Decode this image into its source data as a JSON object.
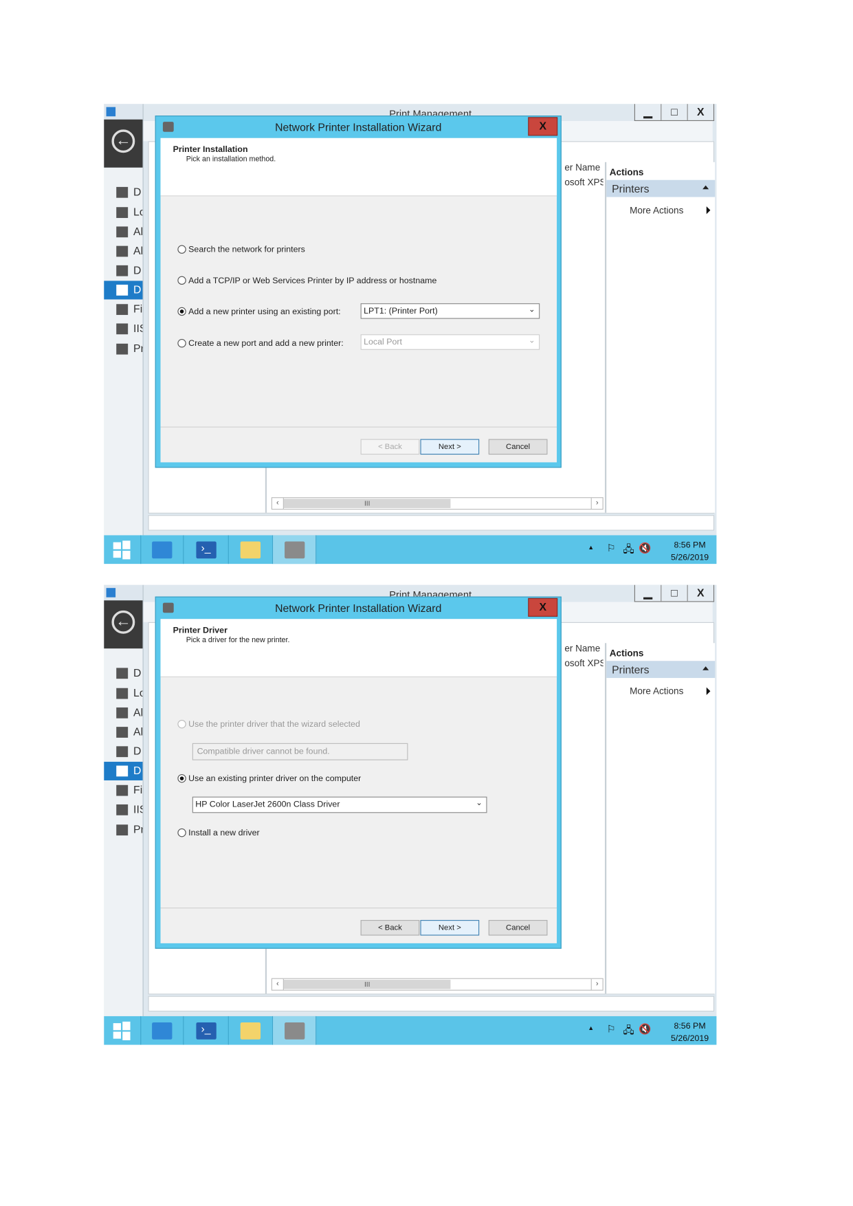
{
  "screenshots": [
    {
      "main_window": {
        "title": "Print Management",
        "minimize": "▁",
        "maximize": "□",
        "close": "X"
      },
      "sidebar": {
        "items": [
          {
            "label": "D",
            "icon": "dashboard-icon"
          },
          {
            "label": "Lo",
            "icon": "local-server-icon"
          },
          {
            "label": "Al",
            "icon": "all-servers-icon"
          },
          {
            "label": "Al",
            "icon": "all-servers-icon"
          },
          {
            "label": "D",
            "icon": "server-icon"
          },
          {
            "label": "D",
            "icon": "print-services-icon",
            "selected": true
          },
          {
            "label": "Fi",
            "icon": "file-services-icon"
          },
          {
            "label": "IIS",
            "icon": "iis-icon"
          },
          {
            "label": "Pr",
            "icon": "printer-icon"
          }
        ]
      },
      "list": {
        "column_header": "er Name",
        "row": "osoft XPS",
        "scroll_thumb": "III"
      },
      "actions": {
        "header": "Actions",
        "section": "Printers",
        "more": "More Actions"
      },
      "taskbar": {
        "time": "8:56 PM",
        "date": "5/26/2019"
      },
      "dialog": {
        "title": "Network Printer Installation Wizard",
        "close": "X",
        "heading": "Printer Installation",
        "subheading": "Pick an installation method.",
        "radios": [
          {
            "label": "Search the network for printers",
            "checked": false,
            "enabled": true
          },
          {
            "label": "Add a TCP/IP or Web Services Printer by IP address or hostname",
            "checked": false,
            "enabled": true
          },
          {
            "label": "Add a new printer using an existing port:",
            "checked": true,
            "enabled": true
          },
          {
            "label": "Create a new port and add a new printer:",
            "checked": false,
            "enabled": true
          }
        ],
        "port_combo": "LPT1: (Printer Port)",
        "new_port_combo": "Local Port",
        "back": "< Back",
        "next": "Next >",
        "cancel": "Cancel",
        "back_enabled": false
      }
    },
    {
      "main_window": {
        "title": "Print Management",
        "minimize": "▁",
        "maximize": "□",
        "close": "X"
      },
      "sidebar": {
        "items": [
          {
            "label": "D",
            "icon": "dashboard-icon"
          },
          {
            "label": "Lo",
            "icon": "local-server-icon"
          },
          {
            "label": "Al",
            "icon": "all-servers-icon"
          },
          {
            "label": "Al",
            "icon": "all-servers-icon"
          },
          {
            "label": "D",
            "icon": "server-icon"
          },
          {
            "label": "D",
            "icon": "print-services-icon",
            "selected": true
          },
          {
            "label": "Fi",
            "icon": "file-services-icon"
          },
          {
            "label": "IIS",
            "icon": "iis-icon"
          },
          {
            "label": "Pr",
            "icon": "printer-icon"
          }
        ]
      },
      "list": {
        "column_header": "er Name",
        "row": "osoft XPS",
        "scroll_thumb": "III"
      },
      "actions": {
        "header": "Actions",
        "section": "Printers",
        "more": "More Actions"
      },
      "taskbar": {
        "time": "8:56 PM",
        "date": "5/26/2019"
      },
      "dialog": {
        "title": "Network Printer Installation Wizard",
        "close": "X",
        "heading": "Printer Driver",
        "subheading": "Pick a driver for the new printer.",
        "radios": [
          {
            "label": "Use the printer driver that the wizard selected",
            "checked": false,
            "enabled": false
          },
          {
            "label": "Use an existing printer driver on the computer",
            "checked": true,
            "enabled": true
          },
          {
            "label": "Install a new driver",
            "checked": false,
            "enabled": true
          }
        ],
        "wizard_driver_box": "Compatible driver cannot be found.",
        "driver_combo": "HP Color LaserJet 2600n Class Driver",
        "back": "< Back",
        "next": "Next >",
        "cancel": "Cancel",
        "back_enabled": true
      }
    }
  ]
}
